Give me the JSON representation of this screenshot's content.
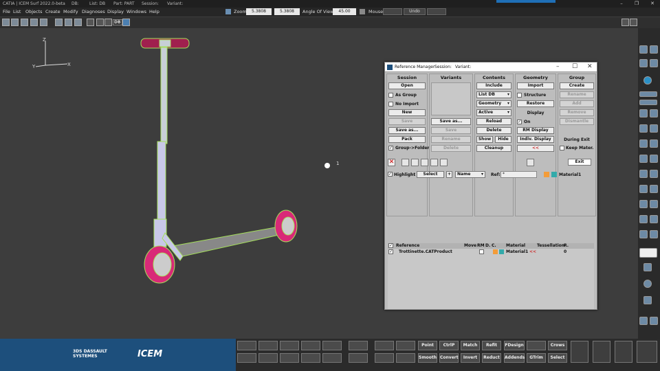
{
  "titlebar": {
    "app": "CATIA | ICEM Surf 2022.0-beta",
    "db": "DB:",
    "list": "List: DB",
    "part": "Part: PART",
    "session": "Session:",
    "variant": "Variant:"
  },
  "menus": [
    "File",
    "List",
    "Objects",
    "Create",
    "Modify",
    "Diagnoses",
    "Display",
    "Windows",
    "Help"
  ],
  "zoom": {
    "label": "Zoom",
    "value1": "5.3808",
    "value2": "5.3808",
    "angle_label": "Angle Of View",
    "angle_value": "45.00",
    "mouse_label": "Mouse",
    "undo_label": "Undo"
  },
  "toolbar": {
    "db_label": "DB"
  },
  "viewport": {
    "point_label": "1",
    "axis_x": "X",
    "axis_y": "Y",
    "axis_z": "Z"
  },
  "dialog": {
    "title": "Reference Manager",
    "session_label": "Session:",
    "variant_label": "Variant:",
    "session": {
      "header": "Session",
      "open": "Open",
      "as_group": "As Group",
      "no_import": "No Import",
      "new": "New",
      "save": "Save",
      "save_as": "Save as...",
      "pack": "Pack",
      "group_folder": "Group->Folder"
    },
    "variants": {
      "header": "Variants",
      "save_as": "Save as...",
      "save": "Save",
      "rename": "Rename",
      "delete": "Delete"
    },
    "contents": {
      "header": "Contents",
      "include": "Include",
      "list_db": "List DB",
      "geometry": "Geometry",
      "active": "Active",
      "reload": "Reload",
      "delete": "Delete",
      "show": "Show",
      "hide": "Hide",
      "cleanup": "Cleanup"
    },
    "geometry": {
      "header": "Geometry",
      "import": "Import",
      "structure": "Structure",
      "restore": "Restore",
      "display_header": "Display",
      "on": "On",
      "rm_display": "RM Display",
      "indiv_display": "Indiv. Display",
      "arrow": "<<"
    },
    "group": {
      "header": "Group",
      "create": "Create",
      "rename": "Rename",
      "add": "Add",
      "remove": "Remove",
      "dismantle": "Dismantle",
      "during_exit": "During Exit",
      "keep_mater": "Keep Mater."
    },
    "exit": "Exit",
    "highlight": "Highlight",
    "select": "Select",
    "name": "Name",
    "ref_label": "Ref:",
    "ref_value": "*",
    "material": "Material1",
    "table": {
      "columns": [
        "Reference",
        "Move",
        "RM",
        "D.",
        "C.",
        "Material",
        "Tessellation",
        "R."
      ],
      "rows": [
        {
          "reference": "Trottinette.CATProduct",
          "material": "Material1",
          "arrow": "<<",
          "r": "0"
        }
      ]
    }
  },
  "bottom": {
    "row1": [
      "Point",
      "CtrlP",
      "Match",
      "Refit",
      "FDesign",
      "Crows"
    ],
    "row2": [
      "Smooth",
      "Convert",
      "Invert",
      "Reduct",
      "Addends",
      "GTrim",
      "Select"
    ],
    "brand_left": "3DS DASSAULT SYSTEMES",
    "brand_right": "ICEM"
  },
  "colors": {
    "accent": "#1d4f7c",
    "viewport": "#3d3d3d",
    "dialog": "#bdbdbd"
  }
}
